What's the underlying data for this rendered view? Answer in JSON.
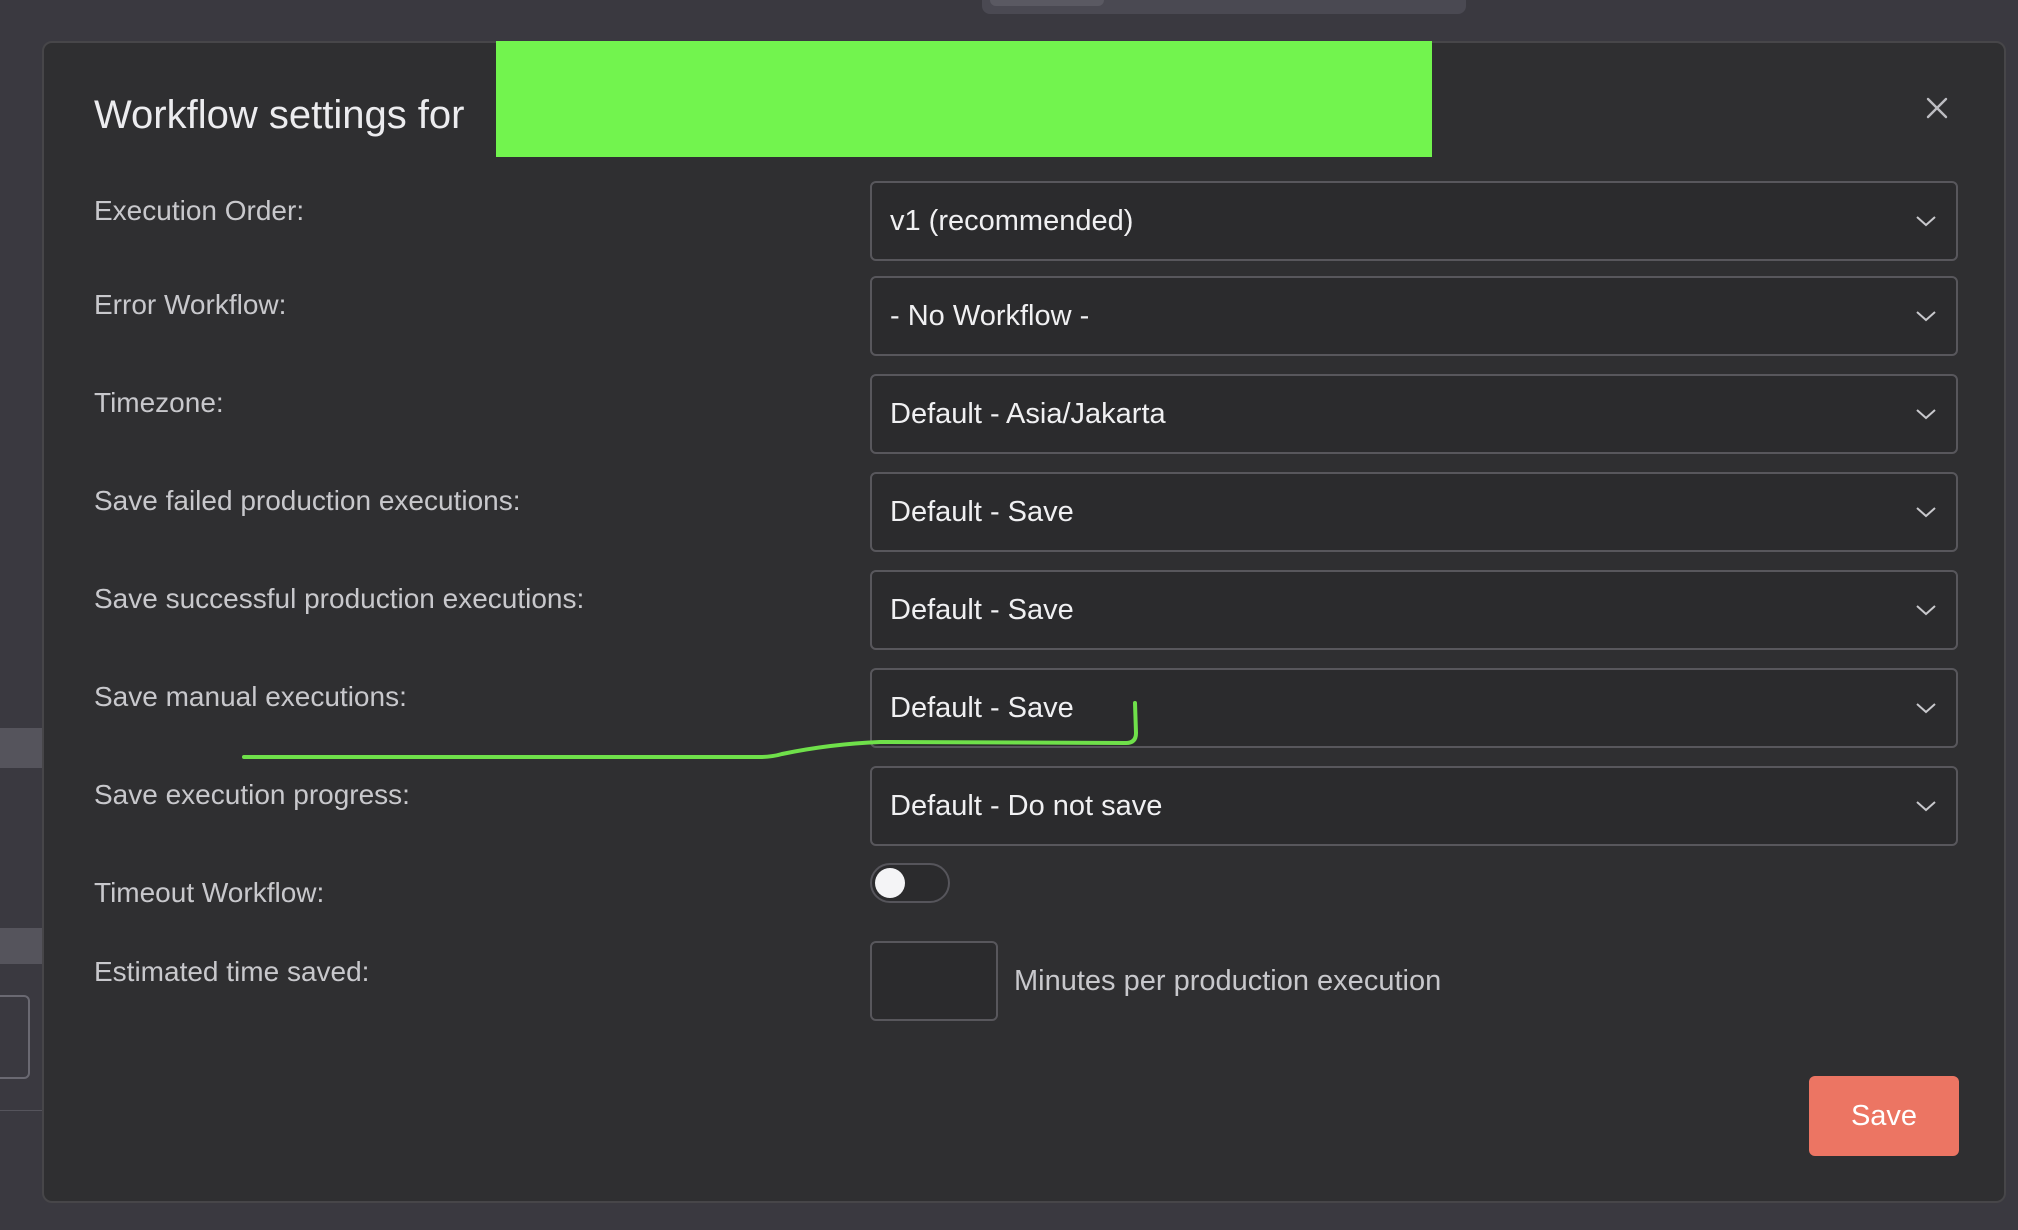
{
  "dialog": {
    "title": "Workflow settings for",
    "close_icon": "close-icon"
  },
  "settings": {
    "execution_order": {
      "label": "Execution Order:",
      "value": "v1 (recommended)"
    },
    "error_workflow": {
      "label": "Error Workflow:",
      "value": "- No Workflow -"
    },
    "timezone": {
      "label": "Timezone:",
      "value": "Default - Asia/Jakarta"
    },
    "save_failed": {
      "label": "Save failed production executions:",
      "value": "Default - Save"
    },
    "save_successful": {
      "label": "Save successful production executions:",
      "value": "Default - Save"
    },
    "save_manual": {
      "label": "Save manual executions:",
      "value": "Default - Save"
    },
    "save_progress": {
      "label": "Save execution progress:",
      "value": "Default - Do not save"
    },
    "timeout_workflow": {
      "label": "Timeout Workflow:",
      "enabled": false
    },
    "estimated_time": {
      "label": "Estimated time saved:",
      "value": "",
      "suffix": "Minutes per production execution"
    }
  },
  "footer": {
    "save_label": "Save"
  },
  "colors": {
    "accent": "#ec7563",
    "redaction": "#72f44e",
    "annotation": "#6fe04a",
    "modal_bg": "#2f2f31"
  }
}
